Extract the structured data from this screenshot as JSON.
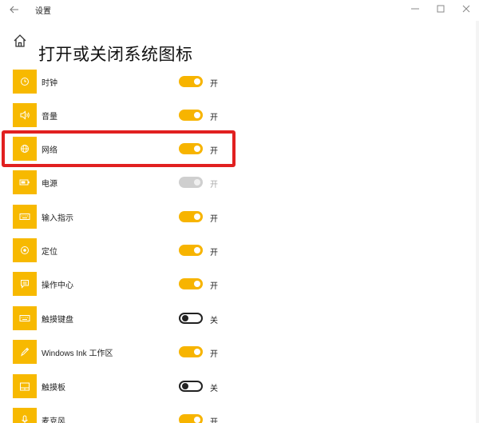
{
  "window": {
    "title": "设置",
    "back_icon": "back-arrow-icon",
    "controls": [
      "minimize-icon",
      "maximize-icon",
      "close-icon"
    ]
  },
  "header": {
    "home_icon": "home-icon",
    "title": "打开或关闭系统图标"
  },
  "colors": {
    "accent": "#f7b400",
    "highlight": "#e12020",
    "tile": "#f7b900"
  },
  "items": [
    {
      "label": "时钟",
      "icon": "clock-icon",
      "state": "on",
      "state_text": "开"
    },
    {
      "label": "音量",
      "icon": "volume-icon",
      "state": "on",
      "state_text": "开"
    },
    {
      "label": "网络",
      "icon": "network-globe-icon",
      "state": "on",
      "state_text": "开",
      "highlighted": true
    },
    {
      "label": "电源",
      "icon": "battery-icon",
      "state": "disabled",
      "state_text": "开"
    },
    {
      "label": "输入指示",
      "icon": "keyboard-icon",
      "state": "on",
      "state_text": "开"
    },
    {
      "label": "定位",
      "icon": "location-icon",
      "state": "on",
      "state_text": "开"
    },
    {
      "label": "操作中心",
      "icon": "action-center-icon",
      "state": "on",
      "state_text": "开"
    },
    {
      "label": "触摸键盘",
      "icon": "touch-keyboard-icon",
      "state": "off",
      "state_text": "关"
    },
    {
      "label": "Windows Ink 工作区",
      "icon": "pen-icon",
      "state": "on",
      "state_text": "开"
    },
    {
      "label": "触摸板",
      "icon": "touchpad-icon",
      "state": "off",
      "state_text": "关"
    },
    {
      "label": "麦克风",
      "icon": "microphone-icon",
      "state": "on",
      "state_text": "开"
    }
  ]
}
